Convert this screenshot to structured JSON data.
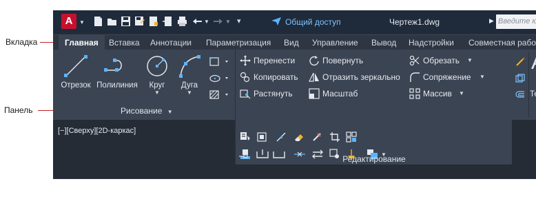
{
  "annotations": {
    "tab_label": "Вкладка",
    "panel_label": "Панель",
    "annotation_color": "#c02020"
  },
  "titlebar": {
    "app_letter": "A",
    "share_label": "Общий доступ",
    "file_title": "Чертеж1.dwg",
    "search_placeholder": "Введите кл"
  },
  "tabs": [
    {
      "label": "Главная",
      "active": true
    },
    {
      "label": "Вставка"
    },
    {
      "label": "Аннотации"
    },
    {
      "label": "Параметризация"
    },
    {
      "label": "Вид"
    },
    {
      "label": "Управление"
    },
    {
      "label": "Вывод"
    },
    {
      "label": "Надстройки"
    },
    {
      "label": "Совместная работ"
    }
  ],
  "draw_panel": {
    "tools": [
      {
        "label": "Отрезок",
        "icon": "line-icon"
      },
      {
        "label": "Полилиния",
        "icon": "polyline-icon"
      },
      {
        "label": "Круг",
        "icon": "circle-icon"
      },
      {
        "label": "Дуга",
        "icon": "arc-icon"
      }
    ],
    "panel_name": "Рисование"
  },
  "modify_panel": {
    "column1": [
      "Перенести",
      "Копировать",
      "Растянуть"
    ],
    "column2": [
      "Повернуть",
      "Отразить зеркально",
      "Масштаб"
    ],
    "column3": [
      "Обрезать",
      "Сопряжение",
      "Массив"
    ],
    "panel_name": "Редактирование"
  },
  "text_panel": {
    "letter": "A",
    "label": "Текс"
  },
  "viewport": {
    "label": "[−][Сверху][2D-каркас]"
  },
  "colors": {
    "titlebar": "#1f2a3a",
    "ribbon": "#3b4453",
    "accent_blue": "#5ab4ff",
    "brand_red": "#c8102e"
  }
}
